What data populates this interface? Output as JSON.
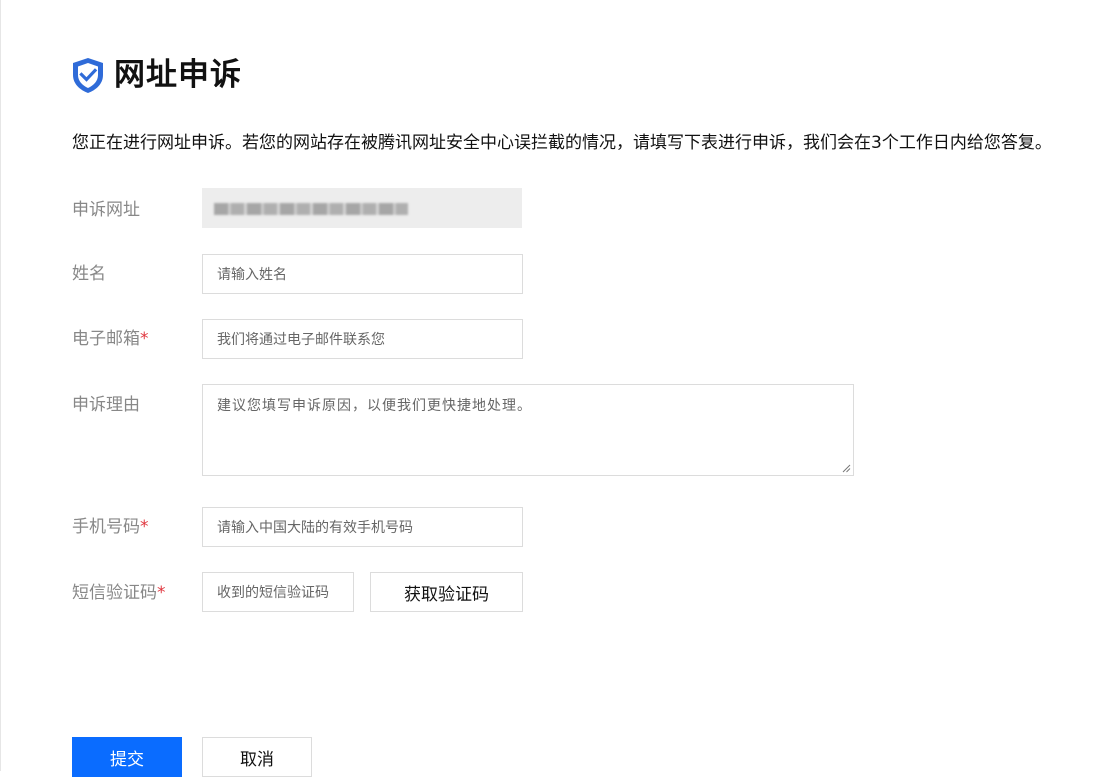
{
  "header": {
    "title": "网址申诉",
    "icon": "shield-check-icon"
  },
  "intro": "您正在进行网址申诉。若您的网站存在被腾讯网址安全中心误拦截的情况，请填写下表进行申诉，我们会在3个工作日内给您答复。",
  "form": {
    "url": {
      "label": "申诉网址"
    },
    "name": {
      "label": "姓名",
      "placeholder": "请输入姓名"
    },
    "email": {
      "label": "电子邮箱",
      "required_mark": "*",
      "placeholder": "我们将通过电子邮件联系您"
    },
    "reason": {
      "label": "申诉理由",
      "placeholder": "建议您填写申诉原因，以便我们更快捷地处理。"
    },
    "phone": {
      "label": "手机号码",
      "required_mark": "*",
      "placeholder": "请输入中国大陆的有效手机号码"
    },
    "sms": {
      "label": "短信验证码",
      "required_mark": "*",
      "placeholder": "收到的短信验证码",
      "get_code_label": "获取验证码"
    }
  },
  "actions": {
    "submit_label": "提交",
    "cancel_label": "取消"
  },
  "colors": {
    "accent": "#0a6cff",
    "required": "#e0373f",
    "icon": "#2f6bd8"
  }
}
